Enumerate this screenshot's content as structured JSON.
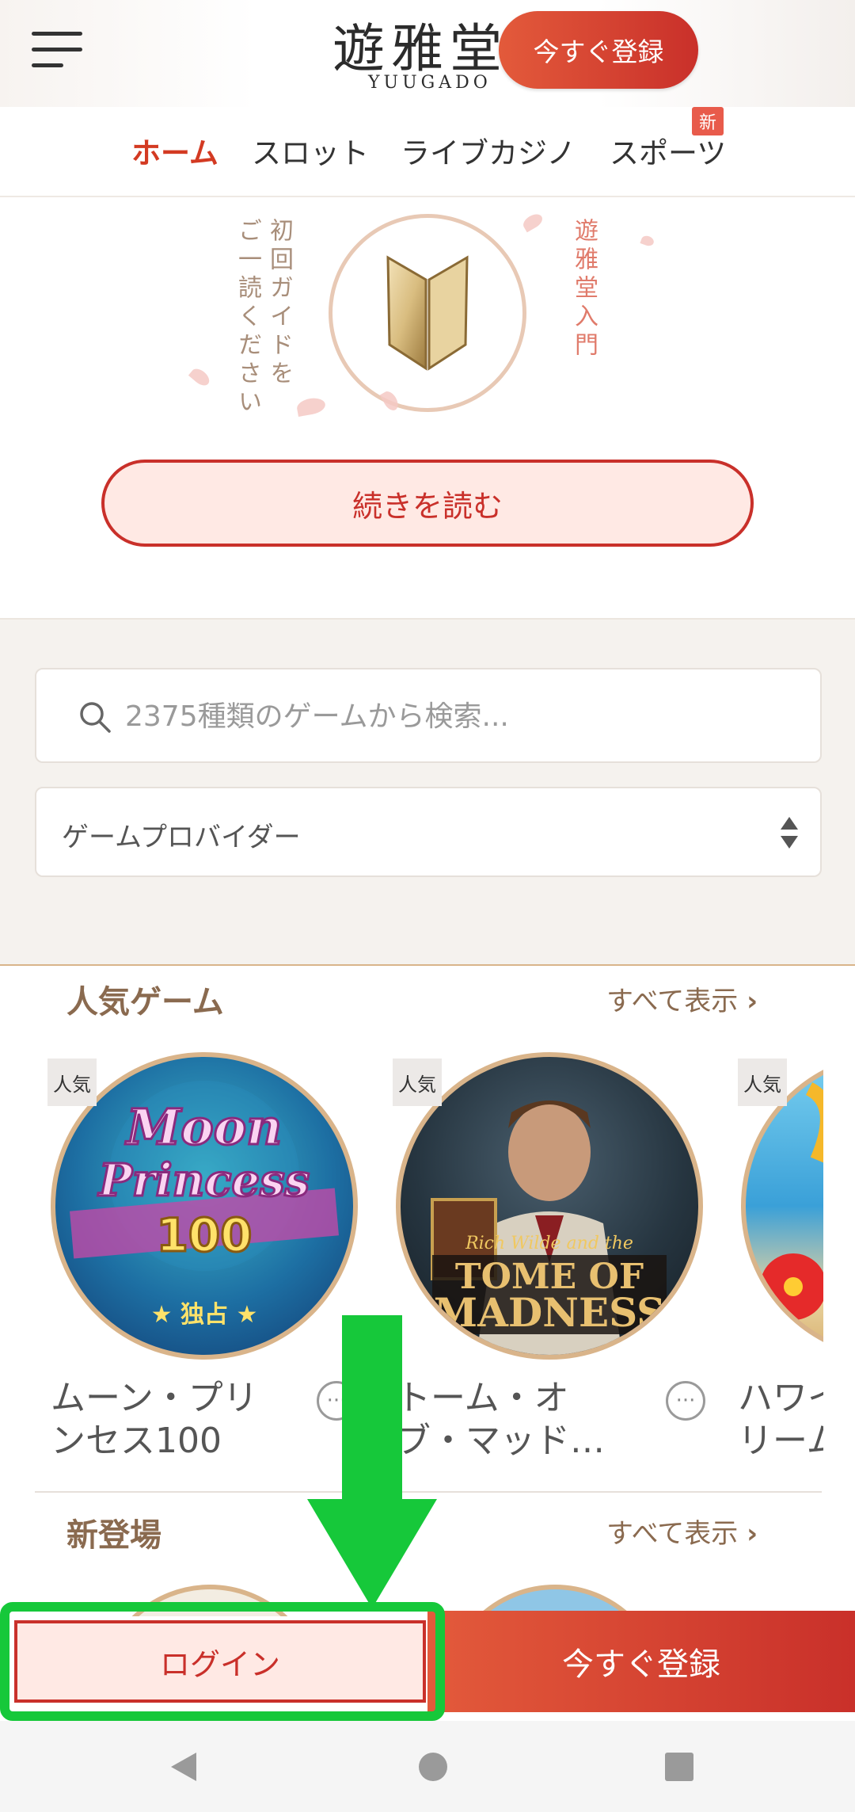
{
  "header": {
    "logo_text": "遊雅堂",
    "logo_sub": "YUUGADO",
    "register_label": "今すぐ登録"
  },
  "nav": {
    "items": [
      {
        "label": "ホーム",
        "active": true
      },
      {
        "label": "スロット",
        "active": false
      },
      {
        "label": "ライブカジノ",
        "active": false
      },
      {
        "label": "スポーツ",
        "active": false,
        "badge": "新"
      }
    ]
  },
  "guide": {
    "left_line1": "初回ガイドを",
    "left_line2": "ご一読ください",
    "right_text": "遊雅堂入門",
    "read_more_label": "続きを読む"
  },
  "search": {
    "placeholder": "2375種類のゲームから検索...",
    "value": "",
    "provider_label": "ゲームプロバイダー"
  },
  "popular": {
    "title": "人気ゲーム",
    "view_all": "すべて表示",
    "games": [
      {
        "tag": "人気",
        "name": "ムーン・プリンセス100",
        "name_line1": "ムーン・プリ",
        "name_line2": "ンセス100",
        "art_lines": [
          "Moon",
          "Princess",
          "100"
        ],
        "art_footer": "★ 独占 ★"
      },
      {
        "tag": "人気",
        "name": "トーム・オブ・マッド…",
        "name_line1": "トーム・オ",
        "name_line2": "ブ・マッド…",
        "art_lines": [
          "Rich Wilde and the",
          "TOME OF",
          "MADNESS"
        ]
      },
      {
        "tag": "人気",
        "name_line1": "ハワイ",
        "name_line2": "リーム"
      }
    ]
  },
  "new_arrivals": {
    "title": "新登場",
    "view_all": "すべて表示"
  },
  "bottom": {
    "login_label": "ログイン",
    "register_label": "今すぐ登録"
  },
  "colors": {
    "accent": "#c9302a",
    "highlight": "#16c83a",
    "section_title": "#8a6a4f"
  }
}
